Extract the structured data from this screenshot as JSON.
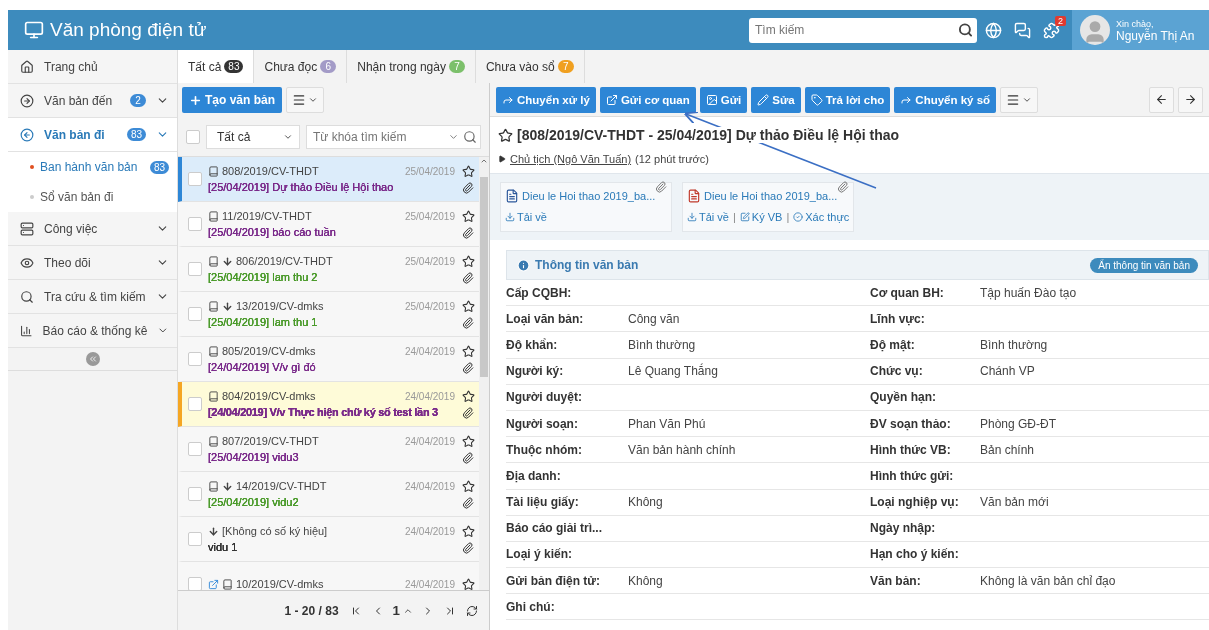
{
  "header": {
    "title": "Văn phòng điện tử",
    "search": {
      "placeholder": "Tìm kiếm"
    },
    "notification_count": "2",
    "greeting": "Xin chào,",
    "user_name": "Nguyễn Thị An"
  },
  "sidebar": {
    "items": [
      {
        "label": "Trang chủ",
        "selected": false,
        "collapsible": false
      },
      {
        "label": "Văn bản đến",
        "badge": "2",
        "selected": false,
        "collapsible": true
      },
      {
        "label": "Văn bản đi",
        "badge": "83",
        "selected": true,
        "collapsible": true,
        "children": [
          {
            "label": "Ban hành văn bản",
            "badge": "83",
            "selected": true
          },
          {
            "label": "Sổ văn bản đi",
            "selected": false
          }
        ]
      },
      {
        "label": "Công việc",
        "selected": false,
        "collapsible": true
      },
      {
        "label": "Theo dõi",
        "selected": false,
        "collapsible": true
      },
      {
        "label": "Tra cứu & tìm kiếm",
        "selected": false,
        "collapsible": true
      },
      {
        "label": "Báo cáo & thống kê",
        "selected": false,
        "collapsible": true
      }
    ]
  },
  "tabs": [
    {
      "label": "Tất cả",
      "count": "83",
      "color": "#333333",
      "selected": true
    },
    {
      "label": "Chưa đọc",
      "count": "6",
      "color": "#a39bc7",
      "selected": false
    },
    {
      "label": "Nhận trong ngày",
      "count": "7",
      "color": "#7cc06b",
      "selected": false
    },
    {
      "label": "Chưa vào sổ",
      "count": "7",
      "color": "#f0a020",
      "selected": false
    }
  ],
  "list": {
    "create_button": "Tạo văn bản",
    "filter": {
      "value": "Tất cả",
      "checked": false
    },
    "search": {
      "placeholder": "Từ khóa tìm kiếm"
    },
    "items": [
      {
        "code": "808/2019/CV-THDT",
        "date": "25/04/2019",
        "title": "[25/04/2019] Dự thảo Điều lệ Hội thao",
        "color": "#7a2a8a",
        "bold": false,
        "incoming": false,
        "forwarded": false,
        "book": true,
        "selected": true,
        "highlighted": false,
        "starred": false,
        "checked": false
      },
      {
        "code": "11/2019/CV-THDT",
        "date": "25/04/2019",
        "title": "[25/04/2019] báo cáo tuần",
        "color": "#7a2a8a",
        "bold": false,
        "incoming": false,
        "forwarded": false,
        "book": true,
        "selected": false,
        "highlighted": false,
        "starred": false,
        "checked": false
      },
      {
        "code": "806/2019/CV-THDT",
        "date": "25/04/2019",
        "title": "[25/04/2019] lam thu 2",
        "color": "#4a9a2a",
        "bold": false,
        "incoming": true,
        "forwarded": false,
        "book": true,
        "selected": false,
        "highlighted": false,
        "starred": false,
        "checked": false
      },
      {
        "code": "13/2019/CV-dmks",
        "date": "25/04/2019",
        "title": "[25/04/2019] lam thu 1",
        "color": "#4a9a2a",
        "bold": false,
        "incoming": true,
        "forwarded": false,
        "book": true,
        "selected": false,
        "highlighted": false,
        "starred": false,
        "checked": false
      },
      {
        "code": "805/2019/CV-dmks",
        "date": "24/04/2019",
        "title": "[24/04/2019] V/v gì đó",
        "color": "#7a2a8a",
        "bold": false,
        "incoming": false,
        "forwarded": false,
        "book": true,
        "selected": false,
        "highlighted": false,
        "starred": false,
        "checked": false
      },
      {
        "code": "804/2019/CV-dmks",
        "date": "24/04/2019",
        "title": "[24/04/2019] V/v Thực hiện chữ ký số test lần 3",
        "color": "#7a2a8a",
        "bold": true,
        "incoming": false,
        "forwarded": false,
        "book": true,
        "selected": false,
        "highlighted": true,
        "starred": false,
        "checked": false
      },
      {
        "code": "807/2019/CV-THDT",
        "date": "24/04/2019",
        "title": "[25/04/2019] vidu3",
        "color": "#7a2a8a",
        "bold": false,
        "incoming": false,
        "forwarded": false,
        "book": true,
        "selected": false,
        "highlighted": false,
        "starred": false,
        "checked": false
      },
      {
        "code": "14/2019/CV-THDT",
        "date": "24/04/2019",
        "title": "[25/04/2019] vidu2",
        "color": "#4a9a2a",
        "bold": false,
        "incoming": true,
        "forwarded": false,
        "book": true,
        "selected": false,
        "highlighted": false,
        "starred": false,
        "checked": false
      },
      {
        "code": "[Không có số ký hiệu]",
        "date": "24/04/2019",
        "title": "vidu 1",
        "color": "#333333",
        "bold": false,
        "incoming": true,
        "forwarded": false,
        "book": false,
        "selected": false,
        "highlighted": false,
        "starred": false,
        "checked": false
      },
      {
        "code": "10/2019/CV-dmks",
        "date": "24/04/2019",
        "incoming": false,
        "forwarded": true,
        "book": true,
        "selected": false,
        "highlighted": false,
        "starred": false,
        "checked": false
      }
    ],
    "pager": {
      "range": "1 - 20 / 83",
      "page": "1"
    }
  },
  "detail": {
    "actions": [
      "Chuyển xử lý",
      "Gửi cơ quan",
      "Gửi",
      "Sửa",
      "Trả lời cho",
      "Chuyển ký số"
    ],
    "title": "[808/2019/CV-THDT - 25/04/2019] Dự thảo Điều lệ Hội thao",
    "starred": false,
    "sender": "Chủ tịch (Ngô Văn Tuấn)",
    "time": "(12 phút trước)",
    "attachments": [
      {
        "kind": "word",
        "name": "Dieu le Hoi thao 2019_ba...",
        "actions": [
          "Tải về"
        ]
      },
      {
        "kind": "pdf",
        "name": "Dieu le Hoi thao 2019_ba...",
        "actions": [
          "Tải về",
          "Ký VB",
          "Xác thực"
        ],
        "separators": [
          "|",
          "|"
        ]
      }
    ],
    "info": {
      "title": "Thông tin văn bản",
      "hide_button": "Ẩn thông tin văn bản",
      "rows": [
        {
          "left": {
            "label": "Cấp CQBH:"
          },
          "right": {
            "label": "Cơ quan BH:",
            "value": "Tập huấn Đào tạo"
          }
        },
        {
          "left": {
            "label": "Loại văn bản:",
            "value": "Công văn"
          },
          "right": {
            "label": "Lĩnh vực:"
          }
        },
        {
          "left": {
            "label": "Độ khẩn:",
            "value": "Bình thường"
          },
          "right": {
            "label": "Độ mật:",
            "value": "Bình thường"
          }
        },
        {
          "left": {
            "label": "Người ký:",
            "value": "Lê Quang Thắng"
          },
          "right": {
            "label": "Chức vụ:",
            "value": "Chánh VP"
          }
        },
        {
          "left": {
            "label": "Người duyệt:"
          },
          "right": {
            "label": "Quyền hạn:"
          }
        },
        {
          "left": {
            "label": "Người soạn:",
            "value": "Phan Văn Phú"
          },
          "right": {
            "label": "ĐV soạn thảo:",
            "value": "Phòng GĐ-ĐT"
          }
        },
        {
          "left": {
            "label": "Thuộc nhóm:",
            "value": "Văn bản hành chính"
          },
          "right": {
            "label": "Hình thức VB:",
            "value": "Bản chính"
          }
        },
        {
          "left": {
            "label": "Địa danh:"
          },
          "right": {
            "label": "Hình thức gửi:"
          }
        },
        {
          "left": {
            "label": "Tài liệu giấy:",
            "value": "Không"
          },
          "right": {
            "label": "Loại nghiệp vụ:",
            "value": "Văn bản mới"
          }
        },
        {
          "left": {
            "label": "Báo cáo giải trì..."
          },
          "right": {
            "label": "Ngày nhập:"
          }
        },
        {
          "left": {
            "label": "Loại ý kiến:"
          },
          "right": {
            "label": "Hạn cho ý kiến:"
          }
        },
        {
          "left": {
            "label": "Gửi bản điện tử:",
            "value": "Không"
          },
          "right": {
            "label": "Văn bản:",
            "value": "Không là văn bản chỉ đạo"
          }
        },
        {
          "left": {
            "label": "Ghi chú:"
          }
        }
      ]
    }
  }
}
